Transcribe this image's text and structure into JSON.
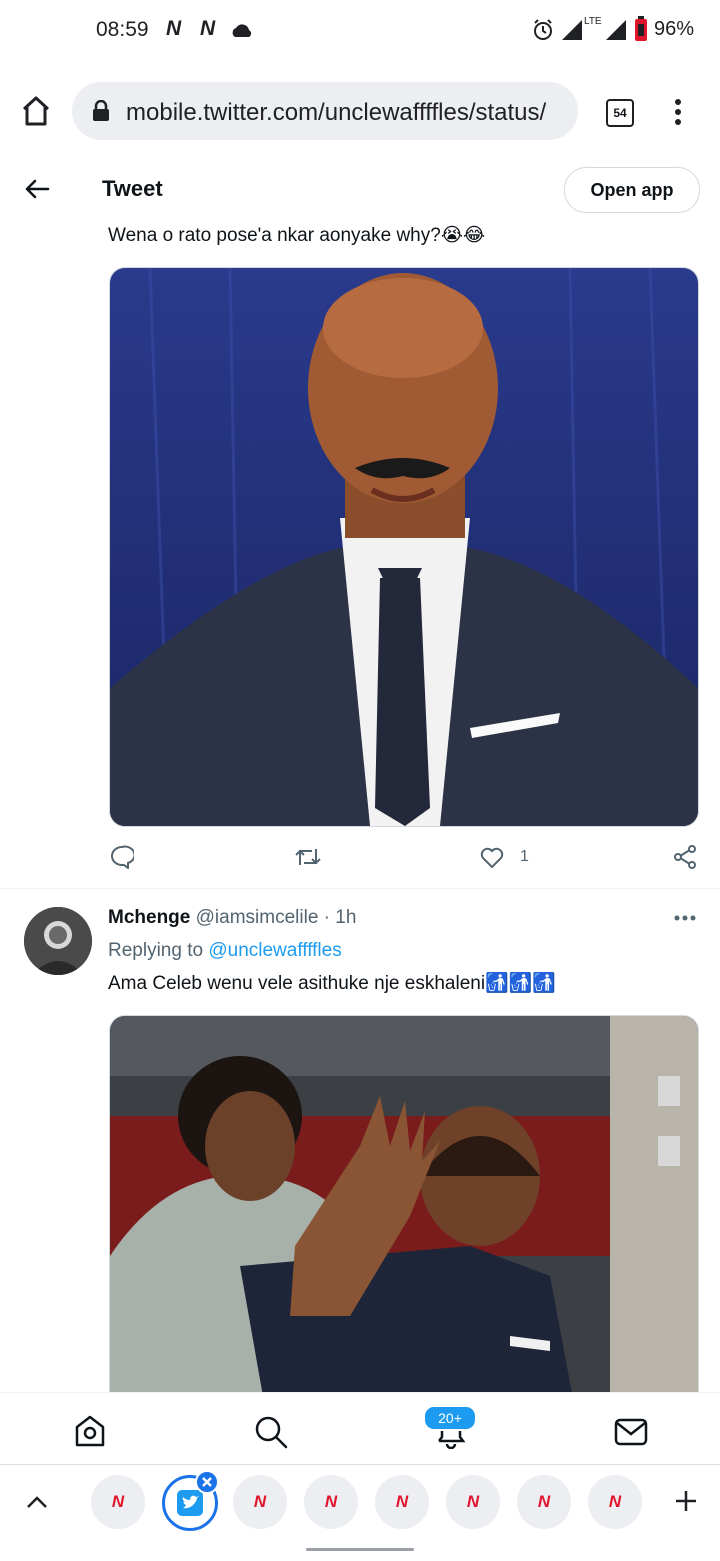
{
  "status_bar": {
    "time": "08:59",
    "notif_glyphs": [
      "N",
      "N"
    ],
    "network": "LTE",
    "battery": "96%"
  },
  "browser": {
    "url": "mobile.twitter.com/unclewaffffles/status/",
    "tab_count": "54"
  },
  "twitter_header": {
    "title": "Tweet",
    "open_app": "Open app"
  },
  "tweet1": {
    "text": "Wena o rato pose'a nkar aonyake why?😭😂",
    "like_count": "1"
  },
  "tweet2": {
    "name": "Mchenge",
    "handle": "@iamsimcelile",
    "dot": "·",
    "time": "1h",
    "replying_label": "Replying to ",
    "replying_handle": "@unclewaffffles",
    "text": "Ama Celeb wenu vele asithuke nje eskhaleni🚮🚮🚮"
  },
  "bottom_nav": {
    "notif_badge": "20+"
  },
  "tab_strip": {
    "tab_glyph": "N"
  },
  "colors": {
    "twitter_blue": "#1d9bf0",
    "news_red": "#e0142b"
  }
}
